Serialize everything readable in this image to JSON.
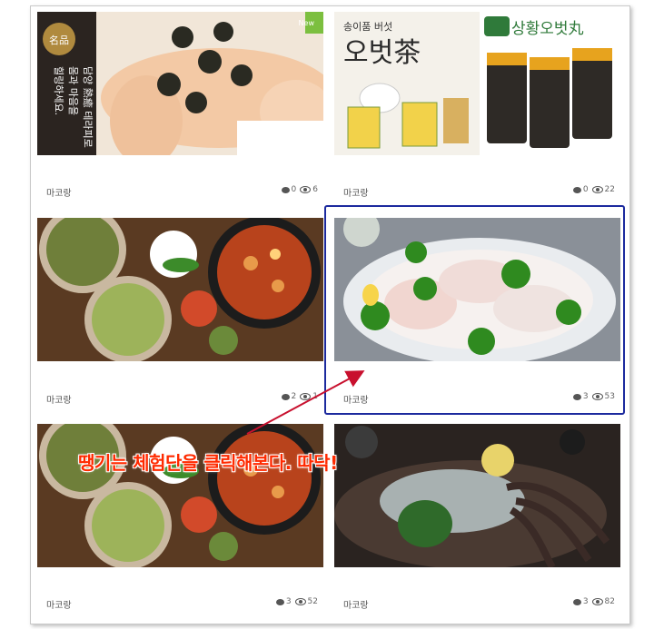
{
  "cards": [
    {
      "author": "마코랑",
      "comments": "0",
      "views": "6",
      "banner_text": "혼몸 담양과 열마 (熱음 癒을 하 를테시 편)라피로",
      "banner_line1": "담양 熱癒 테라피로",
      "banner_line2": "몸과 마음을",
      "banner_line3": "힐링하세요.",
      "badge": "名品",
      "tag": "New"
    },
    {
      "author": "마코랑",
      "comments": "0",
      "views": "22",
      "title_small": "송이품 버섯",
      "title_big": "오벗茶",
      "brand_script": "상황오벗丸"
    },
    {
      "author": "마코랑",
      "comments": "2",
      "views": "1"
    },
    {
      "author": "마코랑",
      "comments": "3",
      "views": "53"
    },
    {
      "author": "마코랑",
      "comments": "3",
      "views": "52"
    },
    {
      "author": "마코랑",
      "comments": "3",
      "views": "82"
    }
  ],
  "annotation": "땡기는 체험단을 클릭해본다. 따닥!",
  "colors": {
    "highlight": "#1c2a9e",
    "annotation": "#ff2a00",
    "arrow": "#c8102e"
  }
}
